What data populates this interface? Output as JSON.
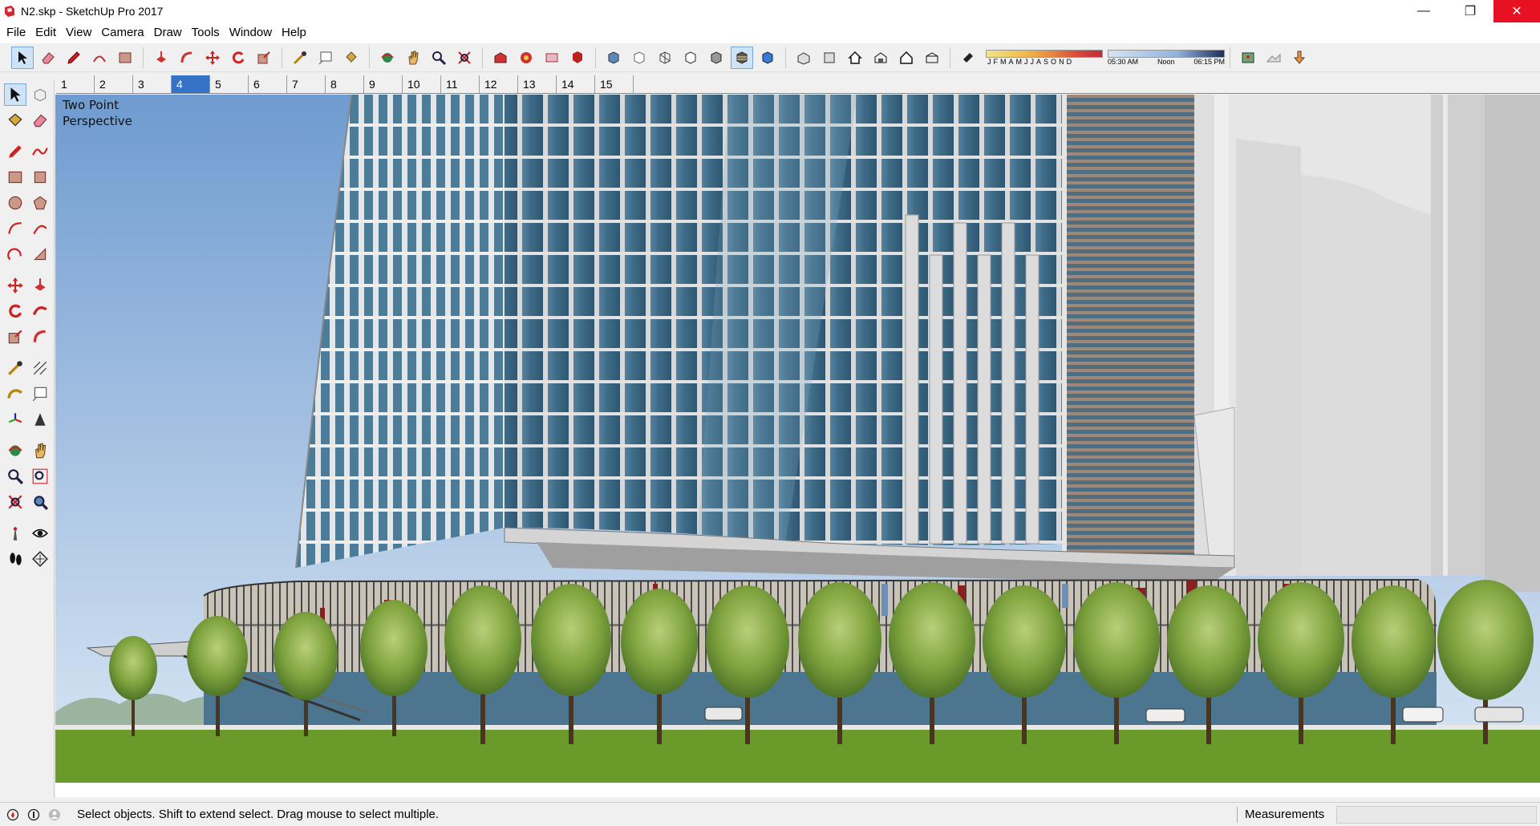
{
  "window": {
    "title": "N2.skp - SketchUp Pro 2017",
    "minimize_glyph": "—",
    "restore_glyph": "❐",
    "close_glyph": "✕"
  },
  "menu": [
    "File",
    "Edit",
    "View",
    "Camera",
    "Draw",
    "Tools",
    "Window",
    "Help"
  ],
  "shadows": {
    "months": [
      "J",
      "F",
      "M",
      "A",
      "M",
      "J",
      "J",
      "A",
      "S",
      "O",
      "N",
      "D"
    ],
    "time_start": "05:30 AM",
    "time_mid": "Noon",
    "time_end": "06:15 PM"
  },
  "scenes": [
    "1",
    "2",
    "3",
    "4",
    "5",
    "6",
    "7",
    "8",
    "9",
    "10",
    "11",
    "12",
    "13",
    "14",
    "15"
  ],
  "active_scene": "4",
  "viewport": {
    "camera_label": "Two Point\nPerspective"
  },
  "status": {
    "message": "Select objects. Shift to extend select. Drag mouse to select multiple.",
    "measurements_label": "Measurements",
    "measurements_value": ""
  },
  "colors": {
    "accent": "#3672c6",
    "close_red": "#e81123",
    "sky": "#7fa7d6",
    "grass": "#6a9a2a",
    "glass": "#3f6f8c"
  }
}
